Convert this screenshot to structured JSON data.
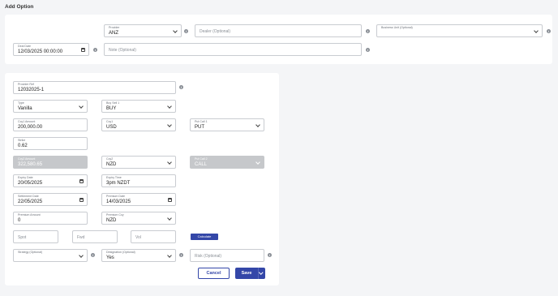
{
  "page": {
    "title": "Add Option"
  },
  "top": {
    "provider": {
      "label": "Provider",
      "value": "ANZ"
    },
    "dealer": {
      "placeholder": "Dealer (Optional)"
    },
    "business_unit": {
      "label": "Business Unit (Optional)",
      "value": ""
    },
    "deal_date": {
      "label": "Deal Date",
      "value": "12/03/2025 00:00:00"
    },
    "note": {
      "placeholder": "Note (Optional)"
    }
  },
  "form": {
    "provider_ref": {
      "label": "Provider Ref",
      "value": "12032025-1"
    },
    "type": {
      "label": "Type",
      "value": "Vanilla"
    },
    "buy_sell": {
      "label": "Buy Sell 1",
      "value": "BUY"
    },
    "ccy1_amount": {
      "label": "Ccy1 Amount",
      "value": "200,000.00"
    },
    "ccy1": {
      "label": "Ccy1",
      "value": "USD"
    },
    "put_call1": {
      "label": "Put Call 1",
      "value": "PUT"
    },
    "strike": {
      "label": "Strike",
      "value": "0.62"
    },
    "ccy2_amount": {
      "label": "Ccy2 Amount",
      "value": "322,580.65"
    },
    "ccy2": {
      "label": "Ccy2",
      "value": "NZD"
    },
    "put_call2": {
      "label": "Put Call 2",
      "value": "CALL"
    },
    "expiry_date": {
      "label": "Expiry Date",
      "value": "20/05/2025"
    },
    "expiry_time": {
      "label": "Expiry Time",
      "value": "3pm NZDT"
    },
    "settlement_date": {
      "label": "Settlement Date",
      "value": "22/05/2025"
    },
    "premium_date": {
      "label": "Premium Date",
      "value": "14/03/2025"
    },
    "premium_amount": {
      "label": "Premium Amount",
      "value": "0"
    },
    "premium_ccy": {
      "label": "Premium Ccy",
      "value": "NZD"
    },
    "spot": {
      "placeholder": "Spot"
    },
    "fwd": {
      "placeholder": "Fwd"
    },
    "vol": {
      "placeholder": "Vol"
    },
    "calculate_label": "Calculate",
    "strategy": {
      "label": "Strategy (Optional)",
      "value": ""
    },
    "designation": {
      "label": "Designation (Optional)",
      "value": "Yes"
    },
    "risk": {
      "placeholder": "Risk (Optional)"
    },
    "cancel_label": "Cancel",
    "save_label": "Save"
  },
  "icons": {
    "info": "info-icon",
    "dropdown": "chevron-down-icon",
    "date": "calendar-icon"
  },
  "colors": {
    "primary": "#3447a8",
    "disabled_field": "#c6c8cb",
    "background": "#f4f5f7"
  }
}
